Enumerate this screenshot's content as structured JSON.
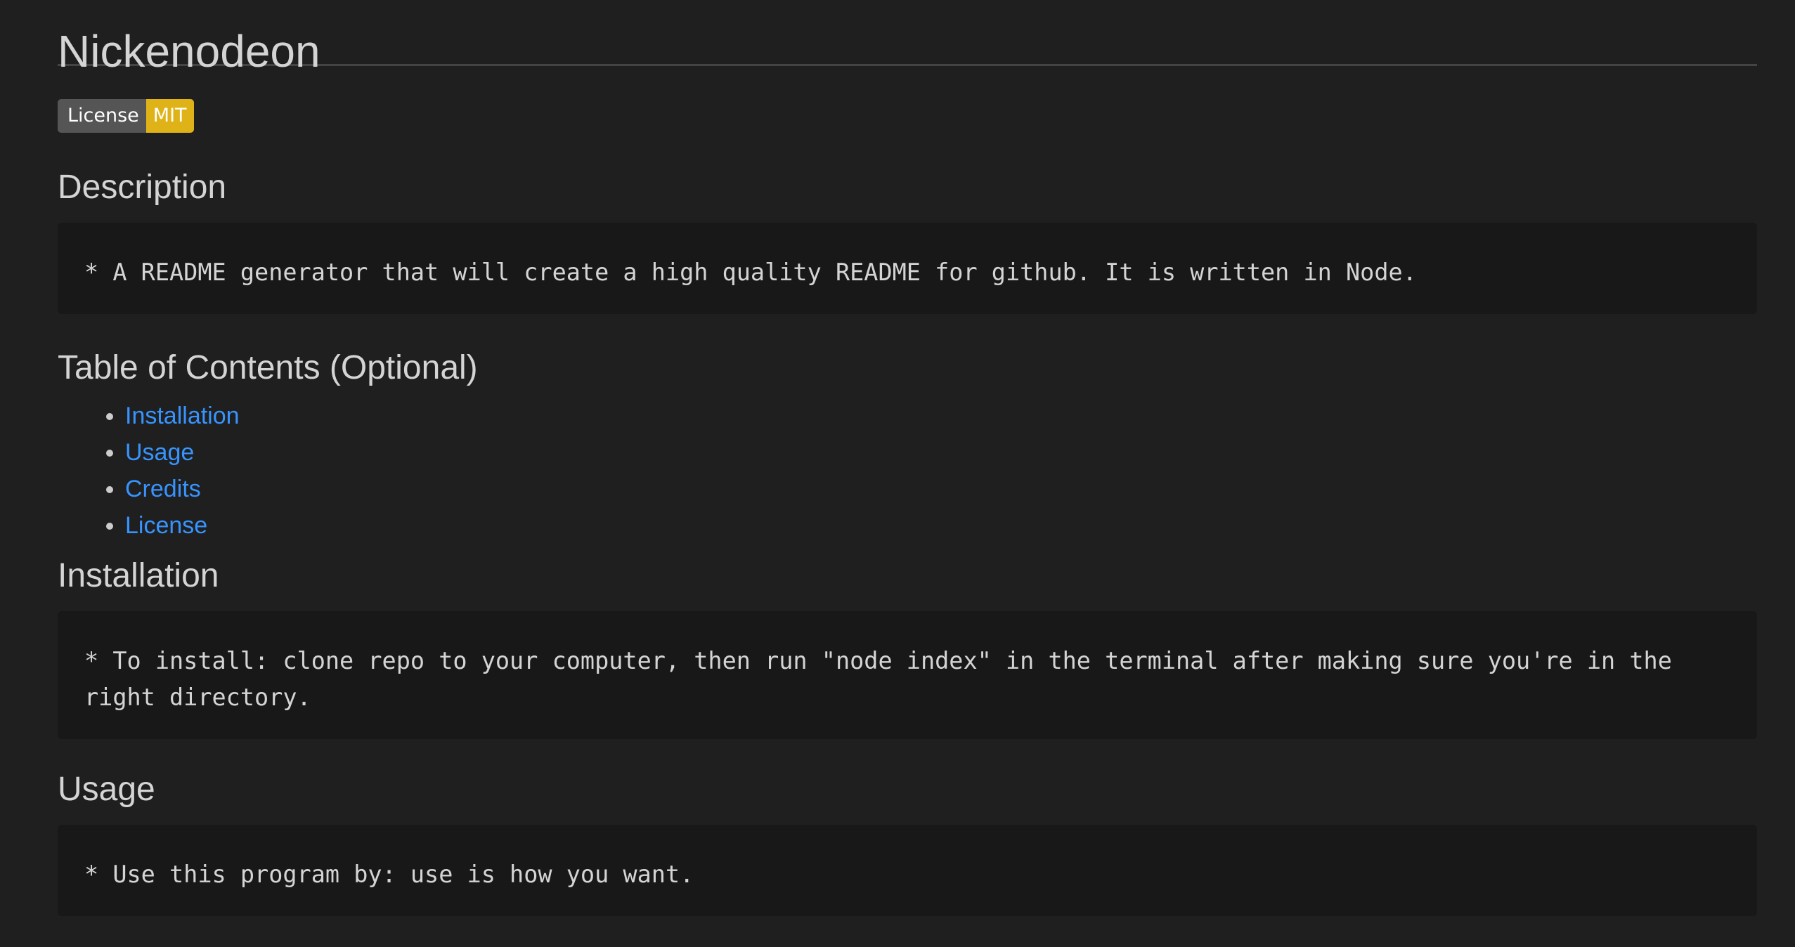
{
  "readme": {
    "title": "Nickenodeon",
    "badge": {
      "label": "License",
      "value": "MIT",
      "label_color": "#555555",
      "value_color": "#dfb317"
    },
    "description": {
      "heading": "Description",
      "text": "* A README generator that will create a high quality README for github. It is written in Node."
    },
    "toc": {
      "heading": "Table of Contents (Optional)",
      "items": [
        {
          "label": "Installation"
        },
        {
          "label": "Usage"
        },
        {
          "label": "Credits"
        },
        {
          "label": "License"
        }
      ]
    },
    "installation": {
      "heading": "Installation",
      "text": "* To install: clone repo to your computer, then run \"node index\" in the terminal after making sure you're in the right directory."
    },
    "usage": {
      "heading": "Usage",
      "text": "* Use this program by: use is how you want."
    }
  },
  "colors": {
    "background": "#1f1f1f",
    "code_background": "#181818",
    "link": "#3794ff",
    "text": "#d4d4d4"
  }
}
